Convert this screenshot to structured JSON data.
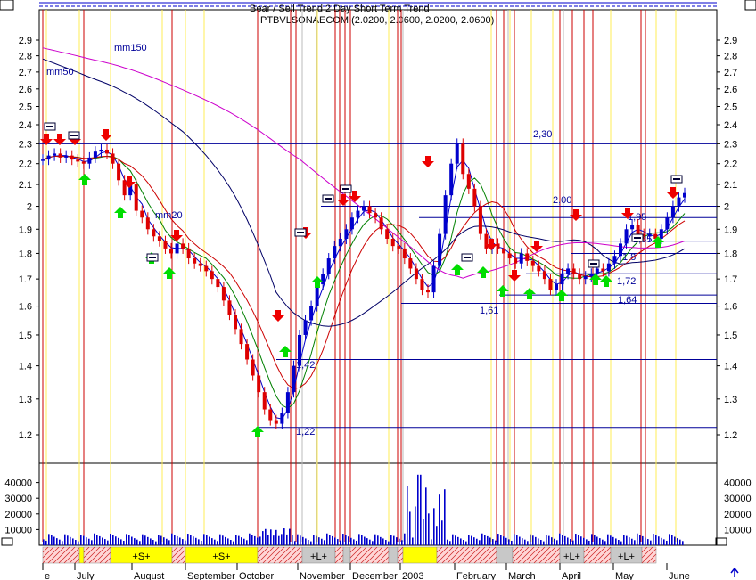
{
  "chart_data": {
    "type": "candlestick",
    "title": "PTBVLSONAECOM (2.0200, 2.0600, 2.0200, 2.0600)",
    "header_text": "Bear / Sell Trend 2 Day Short Term Trend",
    "y_scale": "log",
    "ylim": [
      1.16,
      3.0
    ],
    "price_ticks": [
      2.9,
      2.8,
      2.7,
      2.6,
      2.5,
      2.4,
      2.3,
      2.2,
      2.1,
      2.0,
      1.9,
      1.8,
      1.7,
      1.6,
      1.5,
      1.4,
      1.3,
      1.2
    ],
    "volume_ticks": [
      40000,
      30000,
      20000,
      10000
    ],
    "volume_ylim": [
      0,
      50000
    ],
    "months": [
      "e",
      "July",
      "August",
      "September",
      "October",
      "November",
      "December",
      "2003",
      "February",
      "March",
      "April",
      "May",
      "June"
    ],
    "ma_labels": [
      "mm150",
      "mm50",
      "mm20"
    ],
    "ma_colors": {
      "mm150": "#cc00cc",
      "mm50": "#000066",
      "mm20": "#008000",
      "mm_fast": "#0000cc",
      "mm_slow": "#cc0000"
    },
    "hlines": [
      {
        "value": 2.3,
        "label": "2,30"
      },
      {
        "value": 2.0,
        "label": "2,00"
      },
      {
        "value": 1.95,
        "label": "1,95"
      },
      {
        "value": 1.85,
        "label": "1,85"
      },
      {
        "value": 1.8,
        "label": "1,8"
      },
      {
        "value": 1.72,
        "label": "1,72"
      },
      {
        "value": 1.64,
        "label": "1,64"
      },
      {
        "value": 1.61,
        "label": "1,61"
      },
      {
        "value": 1.42,
        "label": "1,42"
      },
      {
        "value": 1.22,
        "label": "1,22"
      }
    ],
    "band_segments": [
      {
        "type": "x",
        "label": ""
      },
      {
        "type": "y",
        "label": ""
      },
      {
        "type": "x",
        "label": ""
      },
      {
        "type": "y",
        "label": "+S+"
      },
      {
        "type": "x",
        "label": ""
      },
      {
        "type": "y",
        "label": "+S+"
      },
      {
        "type": "x",
        "label": ""
      },
      {
        "type": "g",
        "label": "+L+"
      },
      {
        "type": "x",
        "label": ""
      },
      {
        "type": "g",
        "label": ""
      },
      {
        "type": "x",
        "label": ""
      },
      {
        "type": "g",
        "label": ""
      },
      {
        "type": "x",
        "label": ""
      },
      {
        "type": "y",
        "label": ""
      },
      {
        "type": "x",
        "label": ""
      },
      {
        "type": "g",
        "label": ""
      },
      {
        "type": "x",
        "label": ""
      },
      {
        "type": "g",
        "label": "+L+"
      },
      {
        "type": "x",
        "label": ""
      },
      {
        "type": "g",
        "label": "+L+"
      },
      {
        "type": "x",
        "label": ""
      }
    ],
    "close_series": [
      2.22,
      2.24,
      2.25,
      2.23,
      2.24,
      2.22,
      2.21,
      2.2,
      2.23,
      2.26,
      2.27,
      2.25,
      2.2,
      2.12,
      2.05,
      2.1,
      1.98,
      1.95,
      1.9,
      1.87,
      1.85,
      1.82,
      1.8,
      1.84,
      1.82,
      1.78,
      1.76,
      1.75,
      1.73,
      1.7,
      1.67,
      1.62,
      1.57,
      1.52,
      1.47,
      1.42,
      1.37,
      1.32,
      1.27,
      1.24,
      1.23,
      1.26,
      1.32,
      1.4,
      1.5,
      1.55,
      1.6,
      1.68,
      1.72,
      1.78,
      1.83,
      1.86,
      1.9,
      1.95,
      1.98,
      2.0,
      1.97,
      1.95,
      1.9,
      1.86,
      1.83,
      1.82,
      1.78,
      1.74,
      1.7,
      1.66,
      1.65,
      1.75,
      1.88,
      2.05,
      2.2,
      2.3,
      2.15,
      2.08,
      2.0,
      1.88,
      1.82,
      1.84,
      1.82,
      1.8,
      1.78,
      1.76,
      1.8,
      1.77,
      1.75,
      1.73,
      1.7,
      1.66,
      1.68,
      1.72,
      1.74,
      1.72,
      1.7,
      1.71,
      1.72,
      1.74,
      1.73,
      1.76,
      1.79,
      1.84,
      1.9,
      1.92,
      1.88,
      1.87,
      1.88,
      1.86,
      1.9,
      1.95,
      2.0,
      2.04,
      2.06
    ]
  }
}
